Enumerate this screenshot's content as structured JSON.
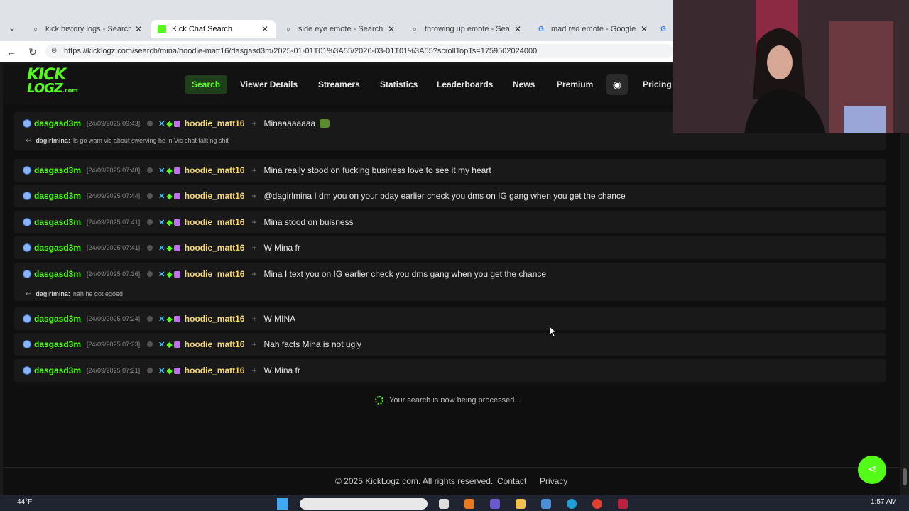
{
  "browser": {
    "tabs": [
      {
        "title": "kick history logs - Search",
        "active": false,
        "icon": "search-icon"
      },
      {
        "title": "Kick Chat Search",
        "active": true,
        "icon": "kicklogz-icon"
      },
      {
        "title": "side eye emote - Search Imag",
        "active": false,
        "icon": "search-icon"
      },
      {
        "title": "throwing up emote - Search I",
        "active": false,
        "icon": "search-icon"
      },
      {
        "title": "mad red emote - Google Sea",
        "active": false,
        "icon": "google-icon"
      }
    ],
    "url": "https://kicklogz.com/search/mina/hoodie-matt16/dasgasd3m/2025-01-01T01%3A55/2026-03-01T01%3A55?scrollTopTs=1759502024000"
  },
  "site": {
    "logo_line1": "KICK",
    "logo_line2": "LOGZ",
    "logo_suffix": ".com",
    "nav": [
      "Search",
      "Viewer Details",
      "Streamers",
      "Statistics",
      "Leaderboards",
      "News",
      "Premium",
      "Pricing"
    ],
    "active_nav": "Search"
  },
  "messages": [
    {
      "user": "dasgasd3m",
      "ts": "[24/09/2025 09:43]",
      "target": "hoodie_matt16",
      "text": "Minaaaaaaaa",
      "emote": true,
      "reply": {
        "user": "dagirlmina:",
        "text": "Is go wam vic about swerving he in Vic chat talking shit"
      }
    },
    {
      "user": "dasgasd3m",
      "ts": "[24/09/2025 07:48]",
      "target": "hoodie_matt16",
      "text": "Mina really stood on fucking business love to see it my heart"
    },
    {
      "user": "dasgasd3m",
      "ts": "[24/09/2025 07:44]",
      "target": "hoodie_matt16",
      "text": "@dagirlmina I dm you on your bday earlier check you dms on IG gang when you get the chance"
    },
    {
      "user": "dasgasd3m",
      "ts": "[24/09/2025 07:41]",
      "target": "hoodie_matt16",
      "text": "Mina stood on buisness"
    },
    {
      "user": "dasgasd3m",
      "ts": "[24/09/2025 07:41]",
      "target": "hoodie_matt16",
      "text": "W Mina fr"
    },
    {
      "user": "dasgasd3m",
      "ts": "[24/09/2025 07:36]",
      "target": "hoodie_matt16",
      "text": "Mina I text you on IG earlier check you dms gang when you get the chance",
      "reply": {
        "user": "dagirlmina:",
        "text": "nah he got egoed"
      }
    },
    {
      "user": "dasgasd3m",
      "ts": "[24/09/2025 07:24]",
      "target": "hoodie_matt16",
      "text": "W MINA"
    },
    {
      "user": "dasgasd3m",
      "ts": "[24/09/2025 07:23]",
      "target": "hoodie_matt16",
      "text": "Nah facts Mina is not ugly"
    },
    {
      "user": "dasgasd3m",
      "ts": "[24/09/2025 07:21]",
      "target": "hoodie_matt16",
      "text": "W Mina fr"
    }
  ],
  "processing_text": "Your search is now being processed...",
  "footer": {
    "copyright": "© 2025 KickLogz.com. All rights reserved.",
    "contact": "Contact",
    "privacy": "Privacy"
  },
  "taskbar": {
    "weather": "44°F",
    "time": "1:57 AM"
  },
  "colors": {
    "accent": "#53fc18",
    "target_name": "#f5d76e",
    "page_bg": "#0f0f10",
    "row_bg": "#191919"
  }
}
